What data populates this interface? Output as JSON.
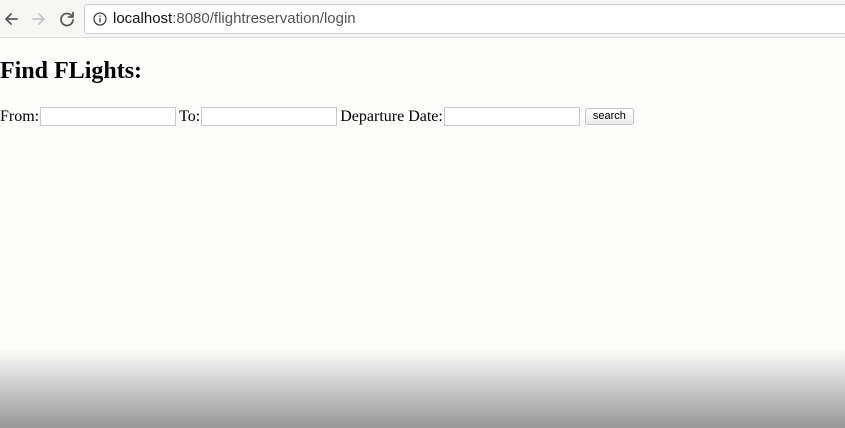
{
  "browser": {
    "url_host": "localhost",
    "url_rest": ":8080/flightreservation/login",
    "icons": {
      "back": "back-arrow-icon",
      "forward": "forward-arrow-icon",
      "reload": "reload-icon",
      "info": "info-icon"
    }
  },
  "page": {
    "title": "Find FLights:",
    "form": {
      "from_label": "From:",
      "from_value": "",
      "to_label": "To:",
      "to_value": "",
      "date_label": "Departure Date:",
      "date_value": "",
      "search_label": "search"
    }
  },
  "colors": {
    "page_background": "#fdfdfc",
    "toolbar_background": "#f6f6f4"
  }
}
